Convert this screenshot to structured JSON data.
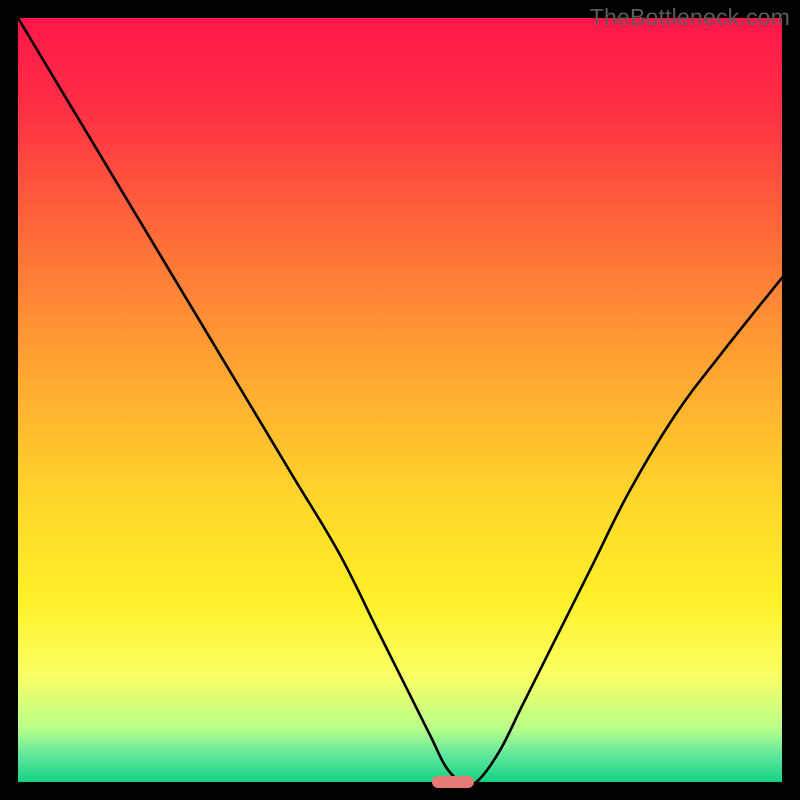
{
  "watermark": "TheBottleneck.com",
  "chart_data": {
    "type": "line",
    "title": "",
    "xlabel": "",
    "ylabel": "",
    "xlim": [
      0,
      100
    ],
    "ylim": [
      0,
      100
    ],
    "grid": false,
    "background_gradient": {
      "type": "vertical",
      "stops": [
        {
          "pos": 0.0,
          "color": "#ff1649"
        },
        {
          "pos": 0.12,
          "color": "#ff3044"
        },
        {
          "pos": 0.28,
          "color": "#ff6a3a"
        },
        {
          "pos": 0.45,
          "color": "#ffa232"
        },
        {
          "pos": 0.62,
          "color": "#ffd42a"
        },
        {
          "pos": 0.76,
          "color": "#fff029"
        },
        {
          "pos": 0.86,
          "color": "#fbff63"
        },
        {
          "pos": 0.93,
          "color": "#b8ff8a"
        },
        {
          "pos": 0.965,
          "color": "#5fe79c"
        },
        {
          "pos": 1.0,
          "color": "#17d183"
        }
      ]
    },
    "series": [
      {
        "name": "bottleneck-curve",
        "x": [
          0,
          6,
          12,
          18,
          24,
          30,
          36,
          42,
          47,
          51,
          54,
          56,
          58,
          60,
          63,
          66,
          70,
          75,
          80,
          86,
          92,
          100
        ],
        "y": [
          100,
          90,
          80,
          70,
          60,
          50,
          40,
          30,
          20,
          12,
          6,
          2,
          0,
          0,
          4,
          10,
          18,
          28,
          38,
          48,
          56,
          66
        ]
      }
    ],
    "annotations": {
      "optimal_marker": {
        "x": 57,
        "y": 0,
        "width_pct": 5.5,
        "height_pct": 1.6,
        "color": "#e77a74"
      }
    }
  }
}
